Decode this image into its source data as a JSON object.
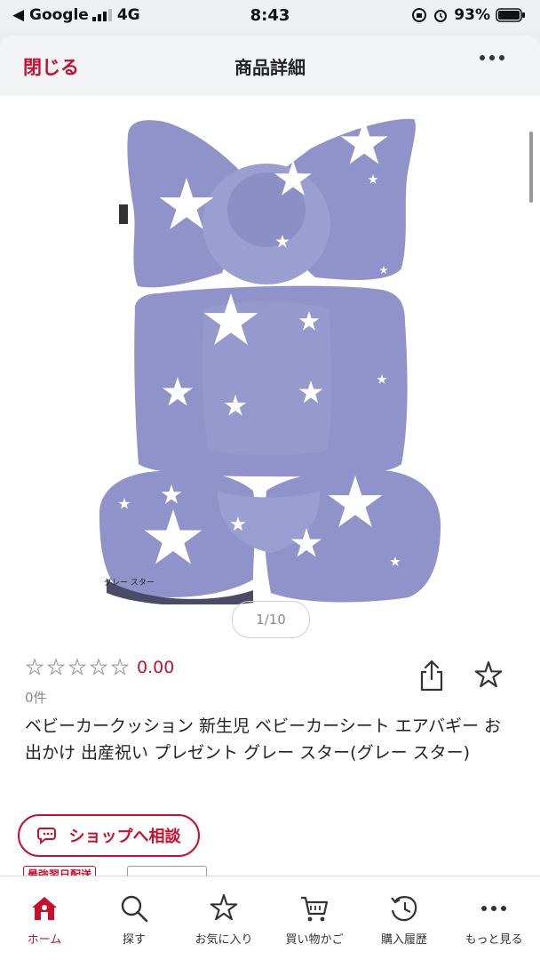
{
  "status_bar": {
    "back_label": "◀ Google",
    "network": "4G",
    "time": "8:43",
    "battery": "93%"
  },
  "header": {
    "close_label": "閉じる",
    "title": "商品詳細"
  },
  "image": {
    "caption": "グレー スター",
    "pager": "1/10",
    "colors": {
      "fabric": "#8f93c9",
      "fabric_shadow": "#7b7fb8",
      "star": "#ffffff"
    }
  },
  "product": {
    "rating_score": "0.00",
    "rating_stars": 0,
    "review_count": "0件",
    "title": "ベビーカークッション 新生児 ベビーカーシート エアバギー お出かけ 出産祝い プレゼント グレー スター(グレー スター)"
  },
  "shop_button": {
    "label": "ショップへ相談"
  },
  "badges": {
    "shipping": "最強翌日配送",
    "points": ""
  },
  "tabs": [
    {
      "label": "ホーム",
      "icon": "home-icon",
      "active": true
    },
    {
      "label": "探す",
      "icon": "search-icon"
    },
    {
      "label": "お気に入り",
      "icon": "star-icon"
    },
    {
      "label": "買い物かご",
      "icon": "cart-icon"
    },
    {
      "label": "購入履歴",
      "icon": "history-icon"
    },
    {
      "label": "もっと見る",
      "icon": "more-icon"
    }
  ],
  "colors": {
    "accent": "#c8102e",
    "star_outline": "#9a9a9a"
  }
}
